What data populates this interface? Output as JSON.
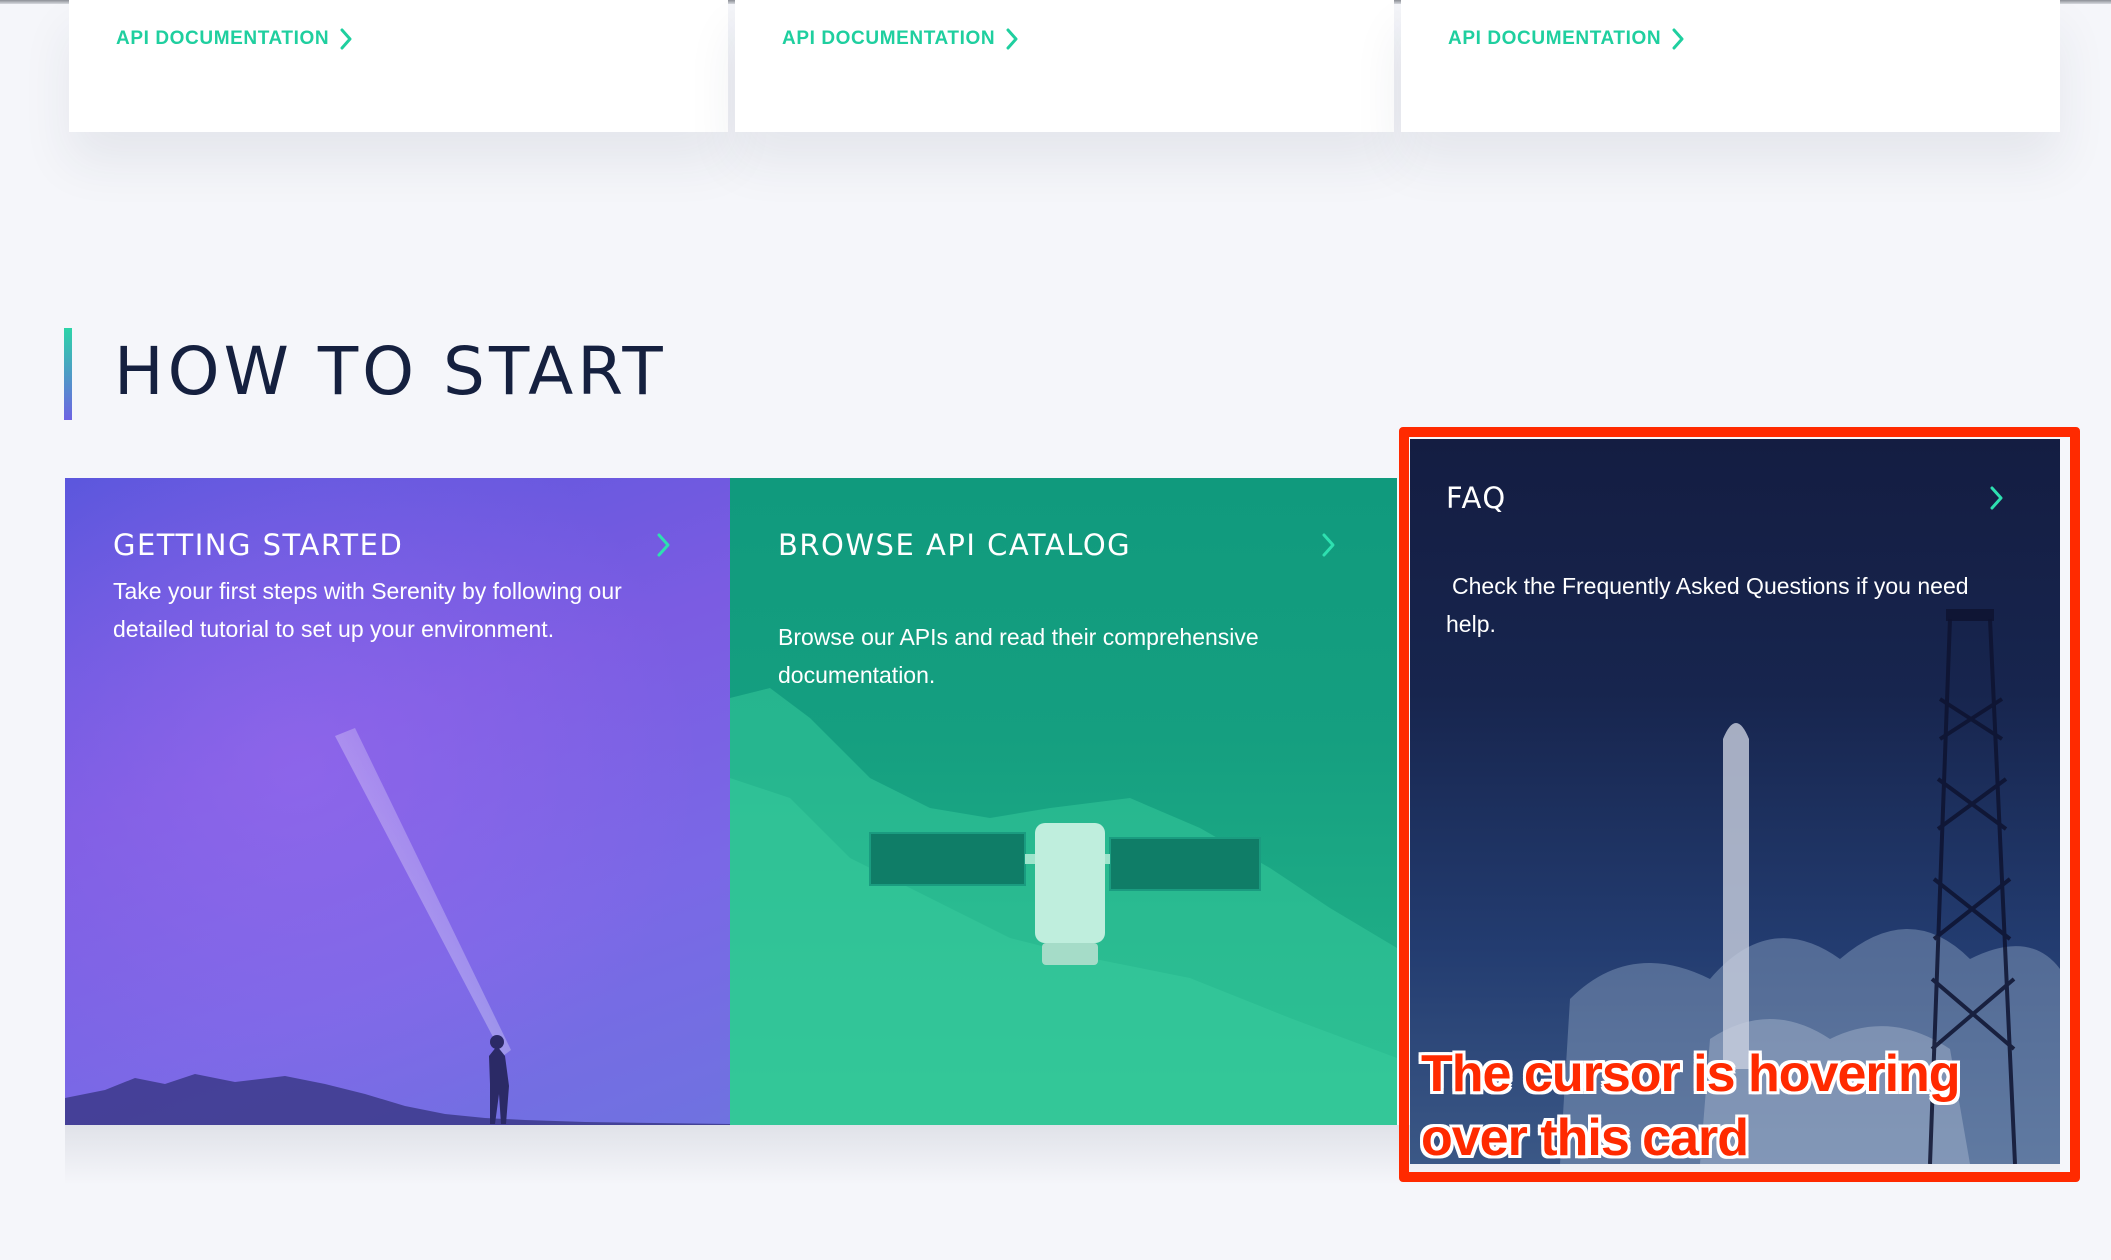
{
  "api_cards": [
    {
      "link_label": "API DOCUMENTATION"
    },
    {
      "link_label": "API DOCUMENTATION"
    },
    {
      "link_label": "API DOCUMENTATION"
    }
  ],
  "how_to_start": {
    "heading": "HOW TO START",
    "cards": [
      {
        "title": "GETTING STARTED",
        "description": "Take your first steps with Serenity by following our detailed tutorial to set up your environment.",
        "arrow_icon": "chevron-right-icon",
        "background": "#6f5fe2"
      },
      {
        "title": "BROWSE API CATALOG",
        "description": "Browse our APIs and read their comprehensive documentation.",
        "arrow_icon": "chevron-right-icon",
        "background": "#17a383"
      },
      {
        "title": "FAQ",
        "description": "Check the Frequently Asked Questions if you need help.",
        "arrow_icon": "chevron-right-icon",
        "background": "#17254e",
        "hovered": true
      }
    ]
  },
  "annotation": {
    "text": "The cursor is hovering over this card",
    "color": "#ff2a00"
  },
  "colors": {
    "accent": "#1fcf9f",
    "heading": "#15203f",
    "page_background": "#f5f6fa"
  }
}
